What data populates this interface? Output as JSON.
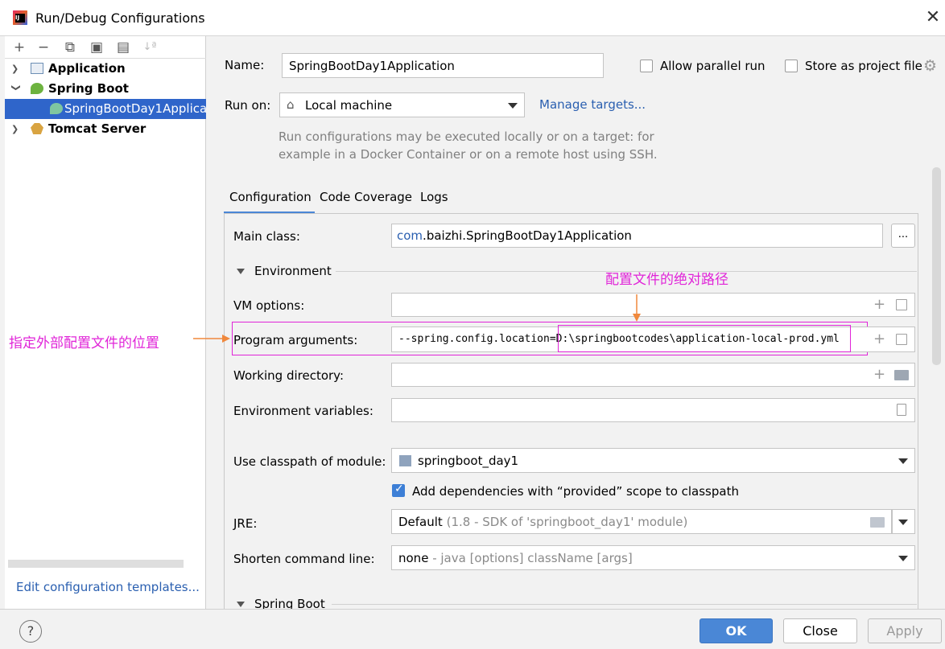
{
  "window": {
    "title": "Run/Debug Configurations"
  },
  "toolbar": {
    "add": "+",
    "remove": "−",
    "copy": "⧉",
    "save": "▣",
    "folder": "▤",
    "sort": "↓ª"
  },
  "tree": {
    "items": [
      {
        "label": "Application",
        "expanded": false
      },
      {
        "label": "Spring Boot",
        "expanded": true
      },
      {
        "label": "SpringBootDay1Applica",
        "selected": true
      },
      {
        "label": "Tomcat Server",
        "expanded": false
      }
    ],
    "edit_templates": "Edit configuration templates..."
  },
  "form": {
    "name_label": "Name:",
    "name_value": "SpringBootDay1Application",
    "allow_parallel": "Allow parallel run",
    "store_project": "Store as project file",
    "run_on_label": "Run on:",
    "run_on_value": "Local machine",
    "manage_targets": "Manage targets...",
    "hint_line1": "Run configurations may be executed locally or on a target: for",
    "hint_line2": "example in a Docker Container or on a remote host using SSH.",
    "tabs": [
      "Configuration",
      "Code Coverage",
      "Logs"
    ],
    "main_class_label": "Main class:",
    "main_class_pkg": "com",
    "main_class_rest": ".baizhi.SpringBootDay1Application",
    "browse": "...",
    "environment_label": "Environment",
    "vm_options_label": "VM options:",
    "program_args_label": "Program arguments:",
    "program_args_prefix": "--spring.config.location=",
    "program_args_path": "D:\\springbootcodes\\application-local-prod.yml",
    "working_dir_label": "Working directory:",
    "env_vars_label": "Environment variables:",
    "classpath_label": "Use classpath of module:",
    "classpath_value": "springboot_day1",
    "add_deps": "Add dependencies with “provided” scope to classpath",
    "jre_label": "JRE:",
    "jre_value": "Default",
    "jre_hint": "(1.8 - SDK of 'springboot_day1' module)",
    "shorten_label": "Shorten command line:",
    "shorten_value": "none",
    "shorten_hint": "- java [options] className [args]",
    "spring_boot_section": "Spring Boot"
  },
  "annotations": {
    "left_note": "指定外部配置文件的位置",
    "top_note": "配置文件的绝对路径",
    "accent": "#e024d8"
  },
  "footer": {
    "help": "?",
    "ok": "OK",
    "close": "Close",
    "apply": "Apply"
  }
}
